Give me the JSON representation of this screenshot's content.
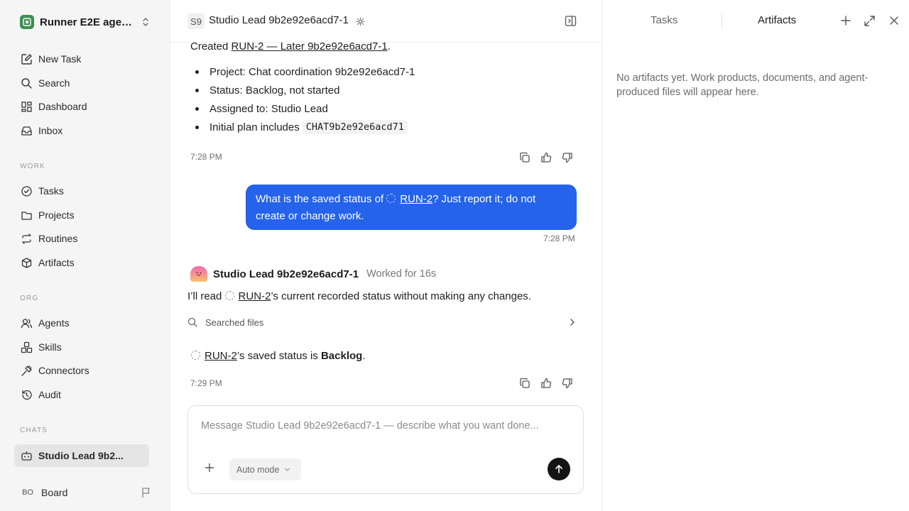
{
  "workspace": {
    "name": "Runner E2E agen..."
  },
  "sidebar": {
    "top_items": [
      {
        "label": "New Task",
        "icon": "edit-icon"
      },
      {
        "label": "Search",
        "icon": "search-icon"
      },
      {
        "label": "Dashboard",
        "icon": "dashboard-icon"
      },
      {
        "label": "Inbox",
        "icon": "inbox-icon"
      }
    ],
    "sections": {
      "work": "WORK",
      "org": "ORG",
      "chats": "CHATS"
    },
    "work_items": [
      {
        "label": "Tasks",
        "icon": "check-circle-icon"
      },
      {
        "label": "Projects",
        "icon": "folder-icon"
      },
      {
        "label": "Routines",
        "icon": "repeat-icon"
      },
      {
        "label": "Artifacts",
        "icon": "box-icon"
      }
    ],
    "org_items": [
      {
        "label": "Agents",
        "icon": "users-icon"
      },
      {
        "label": "Skills",
        "icon": "boxes-icon"
      },
      {
        "label": "Connectors",
        "icon": "plug-icon"
      },
      {
        "label": "Audit",
        "icon": "history-icon"
      }
    ],
    "chat_items": [
      {
        "label": "Studio Lead 9b2...",
        "icon": "bot-icon",
        "active": true
      }
    ],
    "footer": {
      "avatar": "BO",
      "label": "Board"
    }
  },
  "chat": {
    "header": {
      "avatar": "S9",
      "title": "Studio Lead 9b2e92e6acd7-1"
    },
    "msg1": {
      "prefix": "Created ",
      "link": "RUN-2 — Later 9b2e92e6acd7-1",
      "suffix": ".",
      "bullets": [
        "Project: Chat coordination 9b2e92e6acd7-1",
        "Status: Backlog, not started",
        "Assigned to: Studio Lead"
      ],
      "last_bullet_prefix": "Initial plan includes ",
      "last_bullet_code": "CHAT9b2e92e6acd71",
      "time": "7:28 PM"
    },
    "user_msg": {
      "before": "What is the saved status of ",
      "link": "RUN-2",
      "after": "? Just report it; do not create or change work.",
      "time": "7:28 PM"
    },
    "agent": {
      "name": "Studio Lead 9b2e92e6acd7-1",
      "worked": "Worked for 16s",
      "intro_before": "I’ll read ",
      "intro_link": "RUN-2",
      "intro_after": "’s current recorded status without making any changes.",
      "searched": "Searched files",
      "answer_link": "RUN-2",
      "answer_mid": "’s saved status is ",
      "answer_bold": "Backlog",
      "answer_end": ".",
      "time": "7:29 PM"
    },
    "composer": {
      "placeholder": "Message Studio Lead 9b2e92e6acd7-1 — describe what you want done...",
      "mode": "Auto mode"
    }
  },
  "right_panel": {
    "tabs": [
      "Tasks",
      "Artifacts"
    ],
    "active_tab": "Artifacts",
    "empty_text": "No artifacts yet. Work products, documents, and agent-produced files will appear here."
  },
  "colors": {
    "accent": "#2563eb",
    "sidebar_bg": "#f5f5f5",
    "workspace_logo": "#3d8f54"
  }
}
